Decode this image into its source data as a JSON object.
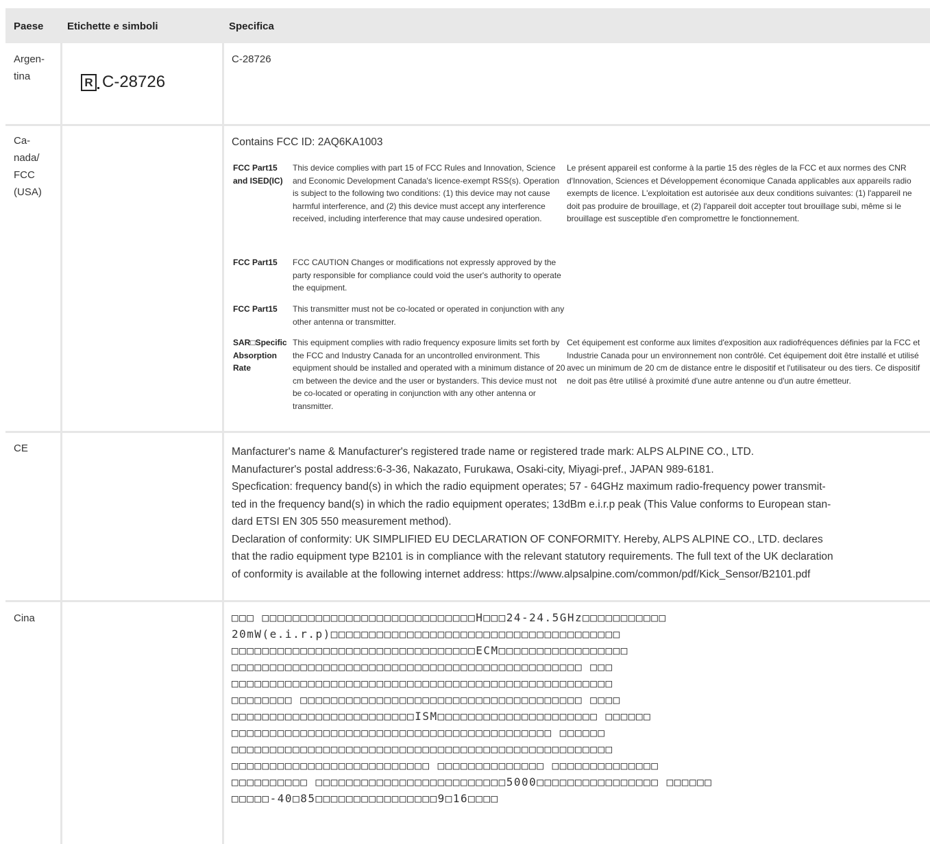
{
  "header": {
    "col1": "Paese",
    "col2": "Etichette e simboli",
    "col3": "Specifica"
  },
  "argentina": {
    "country": "Argen-\ntina",
    "symbol_text": "C-28726",
    "spec": "C-28726"
  },
  "canada": {
    "country": "Ca-\nnada/\nFCC\n(USA)",
    "intro": "Contains FCC ID: 2AQ6KA1003",
    "rows": [
      {
        "label": "FCC Part15 and ISED(IC)",
        "en": "This device complies with part 15 of FCC Rules and Innovation, Science and Economic Development Canada's licence-exempt RSS(s). Operation is subject to the following two conditions: (1) this device may not cause harmful interference, and (2) this device must accept any interference received, including interference that may cause undesired operation.",
        "fr": "Le présent appareil est conforme à la partie 15 des règles de la FCC et aux normes des CNR d'Innovation, Sciences et Développement économique Canada applicables aux appareils radio exempts de licence. L'exploitation est autorisée aux deux conditions suivantes: (1) l'appareil ne doit pas produire de brouillage, et (2) l'appareil doit accepter tout brouillage subi, même si le brouillage est susceptible d'en compromettre le fonctionnement."
      },
      {
        "label": "FCC Part15",
        "en": "FCC CAUTION Changes or modifications not expressly approved by the party responsible for compliance could void the user's authority to operate the equipment.",
        "fr": ""
      },
      {
        "label": "FCC Part15",
        "en": "This transmitter must not be co-located or operated in conjunction with any other antenna or transmitter.",
        "fr": ""
      },
      {
        "label": "SAR□Specific Absorption Rate",
        "en": "This equipment complies with radio frequency exposure limits set forth by the FCC and Industry Canada for an uncontrolled environment. This equipment should be installed and operated with a minimum distance of 20 cm between the device and the user or bystanders. This device must not be co-located or operating in conjunction with any other antenna or transmitter.",
        "fr": "Cet équipement est conforme aux limites d'exposition aux radiofréquences définies par la FCC et Industrie Canada pour un environnement non contrôlé. Cet équipement doit être installé et utilisé avec un minimum de 20 cm de distance entre le dispositif et l'utilisateur ou des tiers. Ce dispositif ne doit pas être utilisé à proximité d'une autre antenne ou d'un autre émetteur."
      }
    ]
  },
  "ce": {
    "country": "CE",
    "lines": [
      "Manfacturer's name & Manufacturer's registered trade name or registered trade mark: ALPS ALPINE CO., LTD.",
      "Manufacturer's postal address:6-3-36, Nakazato, Furukawa, Osaki-city, Miyagi-pref., JAPAN 989-6181.",
      "Specfication: frequency band(s) in which the radio equipment operates; 57 - 64GHz maximum radio-frequency power transmit-",
      "ted in the frequency band(s) in which the radio equipment operates; 13dBm e.i.r.p peak (This Value conforms to European stan-",
      "dard ETSI EN 305 550 measurement method).",
      "Declaration of conformity: UK SIMPLIFIED EU DECLARATION OF CONFORMITY. Hereby, ALPS ALPINE CO., LTD. declares",
      "that the radio equipment type B2101 is in compliance with the relevant statutory requirements.  The full text of the UK declaration",
      "of conformity is available at the following internet address: https://www.alpsalpine.com/common/pdf/Kick_Sensor/B2101.pdf"
    ]
  },
  "china": {
    "country": "Cina",
    "lines": [
      "□□□ □□□□□□□□□□□□□□□□□□□□□□□□□□□□H□□□24-24.5GHz□□□□□□□□□□□",
      "20mW(e.i.r.p)□□□□□□□□□□□□□□□□□□□□□□□□□□□□□□□□□□□□□□",
      "□□□□□□□□□□□□□□□□□□□□□□□□□□□□□□□□ECM□□□□□□□□□□□□□□□□□",
      "□□□□□□□□□□□□□□□□□□□□□□□□□□□□□□□□□□□□□□□□□□□□□□ □□□",
      "□□□□□□□□□□□□□□□□□□□□□□□□□□□□□□□□□□□□□□□□□□□□□□□□□□",
      "□□□□□□□□ □□□□□□□□□□□□□□□□□□□□□□□□□□□□□□□□□□□□□ □□□□",
      "□□□□□□□□□□□□□□□□□□□□□□□□ISM□□□□□□□□□□□□□□□□□□□□□ □□□□□□",
      "□□□□□□□□□□□□□□□□□□□□□□□□□□□□□□□□□□□□□□□□□□ □□□□□□",
      "□□□□□□□□□□□□□□□□□□□□□□□□□□□□□□□□□□□□□□□□□□□□□□□□□□",
      "□□□□□□□□□□□□□□□□□□□□□□□□□□ □□□□□□□□□□□□□□ □□□□□□□□□□□□□□",
      "□□□□□□□□□□ □□□□□□□□□□□□□□□□□□□□□□□□□5000□□□□□□□□□□□□□□□□ □□□□□□",
      "□□□□□-40□85□□□□□□□□□□□□□□□□9□16□□□□"
    ]
  }
}
